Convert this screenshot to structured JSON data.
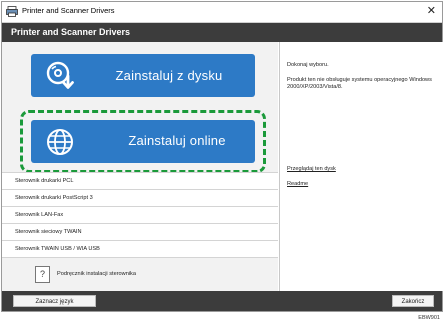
{
  "window": {
    "title": "Printer and Scanner Drivers",
    "close_glyph": "✕"
  },
  "header": {
    "title": "Printer and Scanner Drivers"
  },
  "actions": {
    "install_disk": "Zainstaluj z dysku",
    "install_online": "Zainstaluj online"
  },
  "drivers": [
    "Sterownik drukarki PCL",
    "Sterownik drukarki PostScript 3",
    "Sterownik LAN-Fax",
    "Sterownik sieciowy TWAIN",
    "Sterownik TWAIN USB / WIA USB"
  ],
  "help": {
    "glyph": "?",
    "label": "Podręcznik instalacji sterownika"
  },
  "info": {
    "prompt": "Dokonaj wyboru.",
    "note": "Produkt ten nie obsługuje systemu operacyjnego Windows 2000/XP/2003/Vista/8.",
    "browse_link": "Przeglądaj ten dysk",
    "readme_link": "Readme"
  },
  "footer": {
    "language_button": "Zaznacz język",
    "finish_button": "Zakończ"
  },
  "figure_code": "EBW901",
  "colors": {
    "button_blue": "#2d7ac6",
    "highlight_green": "#1b9a3a",
    "bar_dark": "#3c3c3c"
  }
}
